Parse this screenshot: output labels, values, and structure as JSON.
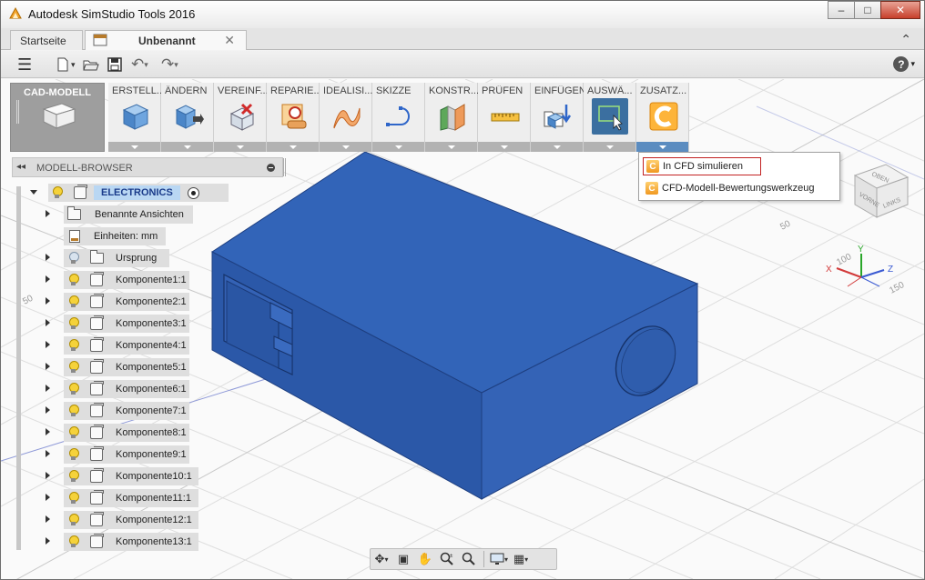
{
  "window": {
    "title": "Autodesk SimStudio Tools 2016",
    "controls": {
      "minimize": "–",
      "maximize": "□",
      "close": "✕"
    }
  },
  "tabs": {
    "home": "Startseite",
    "document": "Unbenannt",
    "close_glyph": "✕",
    "collapse_glyph": "⌃"
  },
  "qat": {
    "menu": "☰",
    "new_caret": "▾",
    "undo": "↶",
    "redo": "↷",
    "caret": "▾",
    "help": "?",
    "help_caret": "▾"
  },
  "ribbon": {
    "workspace": "CAD-MODELL",
    "groups": [
      {
        "label": "ERSTELL...",
        "icon": "box-icon"
      },
      {
        "label": "ÄNDERN",
        "icon": "modify-icon"
      },
      {
        "label": "VEREINF...",
        "icon": "simplify-icon"
      },
      {
        "label": "REPARIE...",
        "icon": "repair-icon"
      },
      {
        "label": "IDEALISI...",
        "icon": "idealize-icon"
      },
      {
        "label": "SKIZZE",
        "icon": "sketch-icon"
      },
      {
        "label": "KONSTR...",
        "icon": "construct-icon"
      },
      {
        "label": "PRÜFEN",
        "icon": "measure-icon"
      },
      {
        "label": "EINFÜGEN",
        "icon": "insert-icon"
      },
      {
        "label": "AUSWÄ...",
        "icon": "select-icon"
      },
      {
        "label": "ZUSATZ...",
        "icon": "addins-icon"
      }
    ]
  },
  "dropdown": {
    "items": [
      {
        "label": "In CFD simulieren",
        "icon": "cfd-icon",
        "highlighted": true
      },
      {
        "label": "CFD-Modell-Bewertungswerkzeug",
        "icon": "cfd-icon",
        "highlighted": false
      }
    ]
  },
  "browser": {
    "title": "MODELL-BROWSER",
    "collapse_glyph": "◂◂",
    "root": "ELECTRONICS",
    "items": [
      {
        "label": "Benannte Ansichten",
        "icon": "folder-icon",
        "bulb": false
      },
      {
        "label": "Einheiten: mm",
        "icon": "units-icon",
        "bulb": false
      },
      {
        "label": "Ursprung",
        "icon": "folder-icon",
        "bulb": "grey"
      },
      {
        "label": "Komponente1:1",
        "icon": "component-icon",
        "bulb": true
      },
      {
        "label": "Komponente2:1",
        "icon": "component-icon",
        "bulb": true
      },
      {
        "label": "Komponente3:1",
        "icon": "component-icon",
        "bulb": true
      },
      {
        "label": "Komponente4:1",
        "icon": "component-icon",
        "bulb": true
      },
      {
        "label": "Komponente5:1",
        "icon": "component-icon",
        "bulb": true
      },
      {
        "label": "Komponente6:1",
        "icon": "component-icon",
        "bulb": true
      },
      {
        "label": "Komponente7:1",
        "icon": "component-icon",
        "bulb": true
      },
      {
        "label": "Komponente8:1",
        "icon": "component-icon",
        "bulb": true
      },
      {
        "label": "Komponente9:1",
        "icon": "component-icon",
        "bulb": true
      },
      {
        "label": "Komponente10:1",
        "icon": "component-icon",
        "bulb": true
      },
      {
        "label": "Komponente11:1",
        "icon": "component-icon",
        "bulb": true
      },
      {
        "label": "Komponente12:1",
        "icon": "component-icon",
        "bulb": true
      },
      {
        "label": "Komponente13:1",
        "icon": "component-icon",
        "bulb": true
      }
    ]
  },
  "viewport": {
    "grid_labels": [
      "50",
      "100",
      "150",
      "50"
    ],
    "viewcube": {
      "top": "OBEN",
      "front": "VORNE",
      "right": "LINKS"
    },
    "axes": {
      "x": "X",
      "y": "Y",
      "z": "Z"
    }
  },
  "navbar": {
    "orbit": "✥",
    "look": "▣",
    "pan": "✋",
    "zoom": "🔍",
    "fit": "⌕",
    "display": "▭",
    "grid": "▦",
    "caret": "▾"
  },
  "colors": {
    "model_blue": "#2f5fb3",
    "ribbon_bg": "#eeeeee",
    "workspace_bg": "#9e9e9e",
    "highlight_red": "#c22222"
  }
}
